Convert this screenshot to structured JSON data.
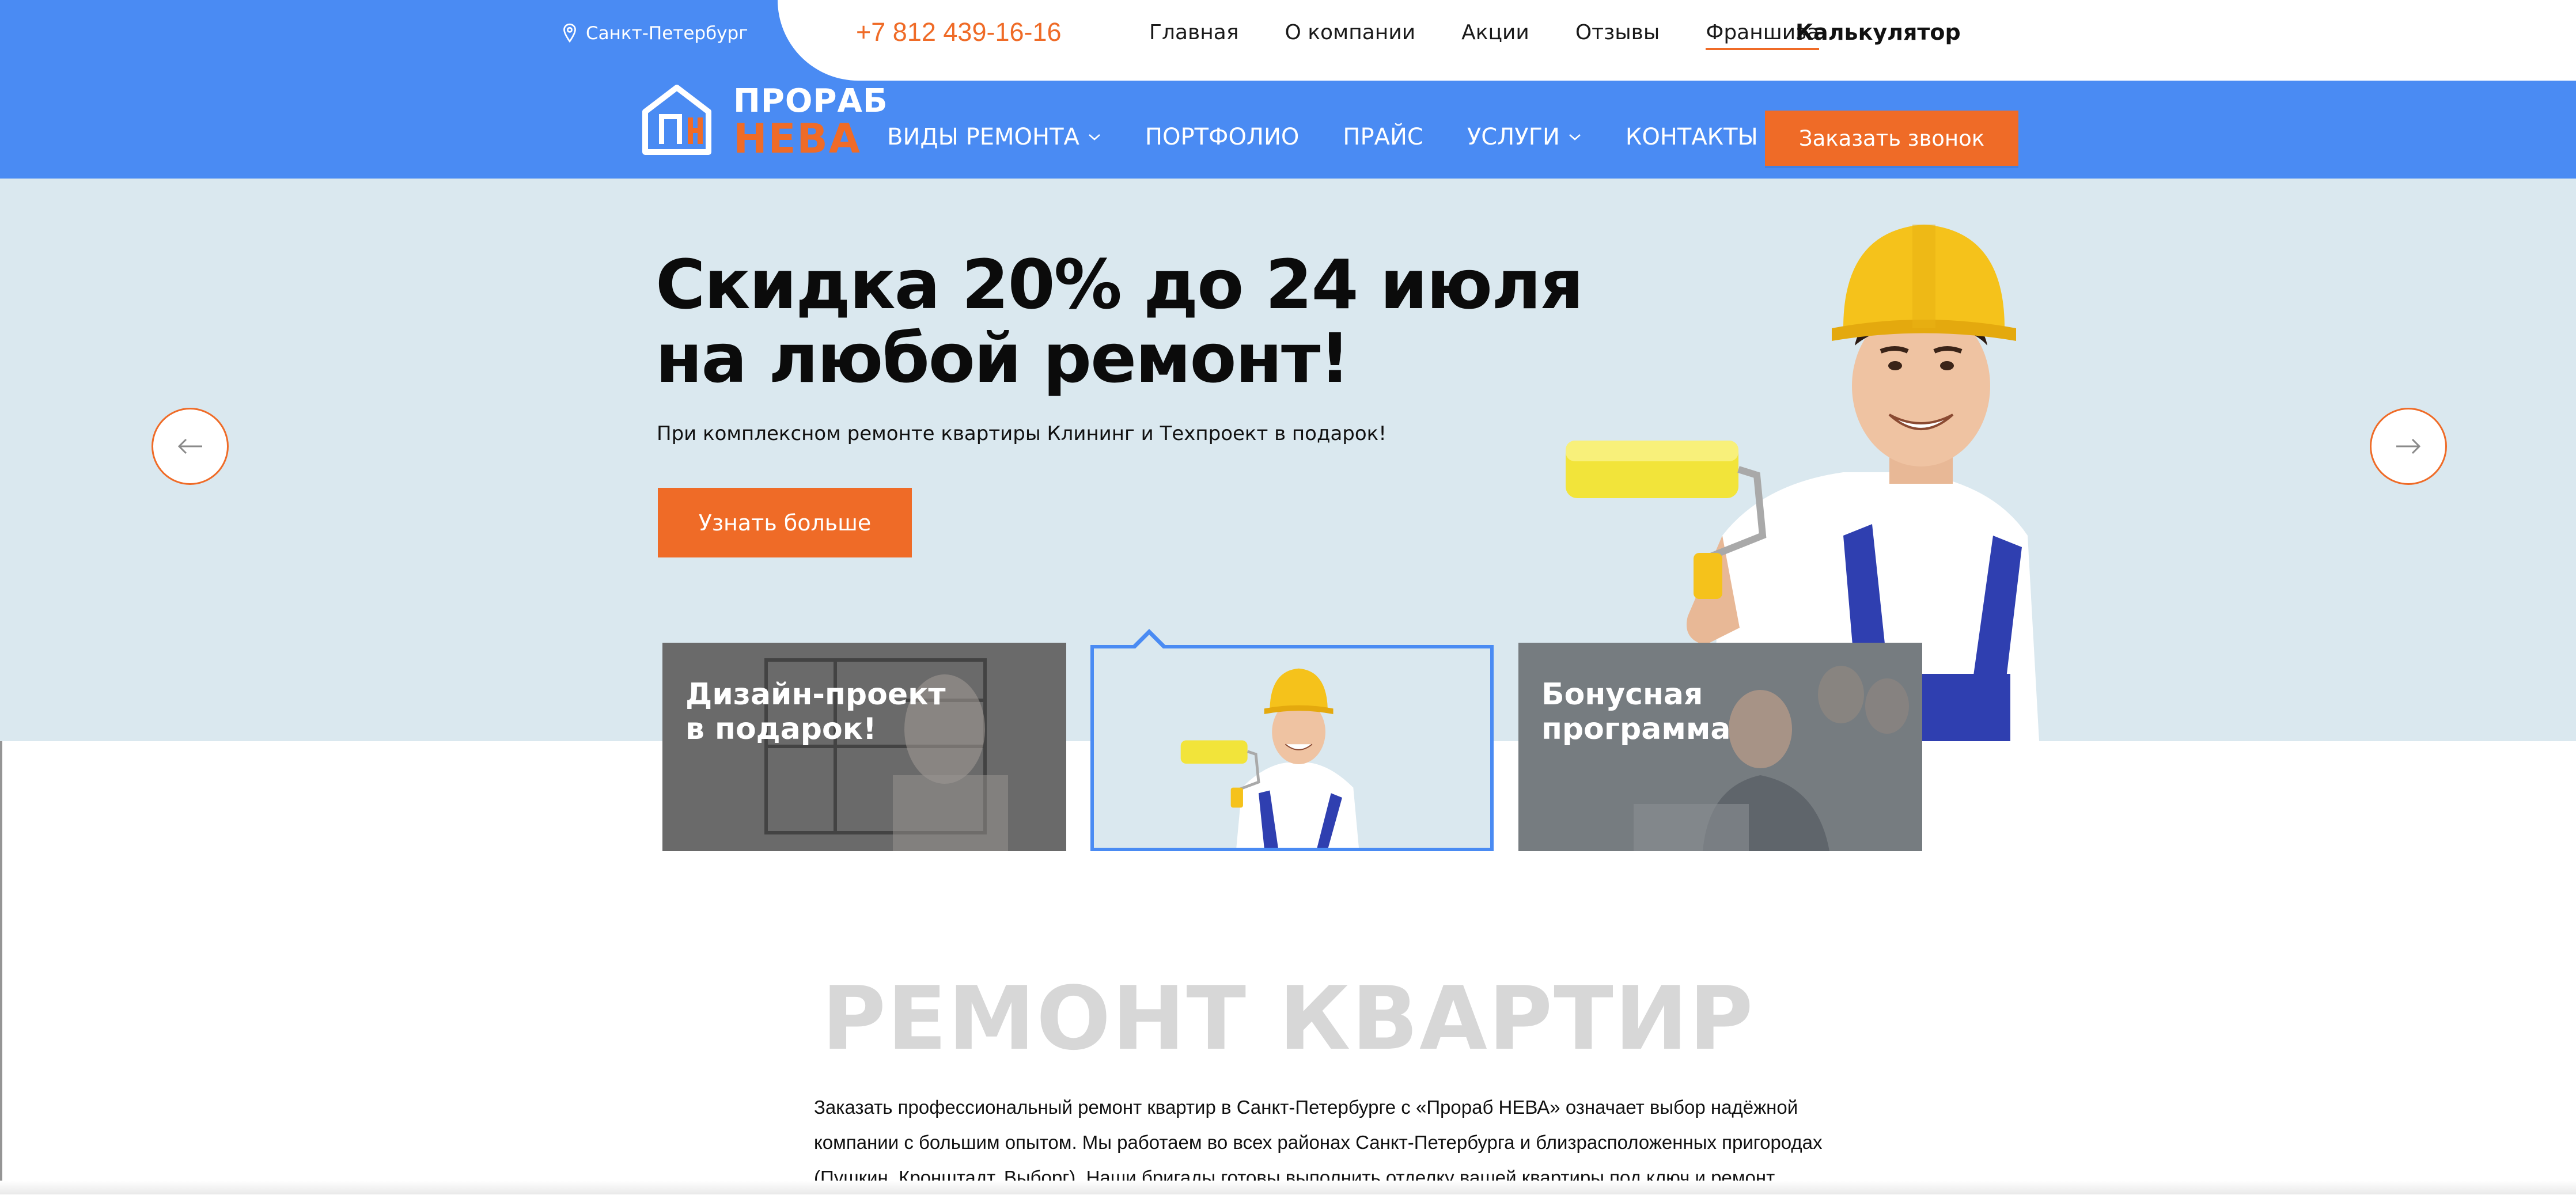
{
  "topbar": {
    "city": "Санкт-Петербург",
    "phone": "+7 812 439-16-16",
    "nav": [
      "Главная",
      "О компании",
      "Акции",
      "Отзывы",
      "Франшиза"
    ],
    "calculator": "Калькулятор"
  },
  "logo": {
    "line1": "ПРОРАБ",
    "line2": "НЕВА"
  },
  "menu": {
    "items": [
      "ВИДЫ РЕМОНТА",
      "ПОРТФОЛИО",
      "ПРАЙС",
      "УСЛУГИ",
      "КОНТАКТЫ"
    ],
    "call_button": "Заказать звонок"
  },
  "hero": {
    "title_line1": "Скидка 20% до 24 июля",
    "title_line2": "на любой ремонт!",
    "subtitle": "При комплексном ремонте квартиры Клининг и Техпроект в подарок!",
    "button": "Узнать больше"
  },
  "cards": {
    "card1_line1": "Дизайн-проект",
    "card1_line2": "в подарок!",
    "card3_line1": "Бонусная",
    "card3_line2": "программа"
  },
  "section": {
    "title": "РЕМОНТ КВАРТИР",
    "text_line1": "Заказать профессиональный ремонт квартир в Санкт-Петербурге с «Прораб НЕВА» означает выбор надёжной",
    "text_line2": "компании с большим опытом. Мы работаем во всех районах Санкт-Петербурга и близрасположенных пригородах",
    "text_line3": "(Пушкин, Кронштадт, Выборг). Наши бригады готовы выполнить отделку вашей квартиры под ключ и ремонт"
  },
  "colors": {
    "primary_blue": "#4a8bf3",
    "accent_orange": "#ef6b27",
    "hero_bg": "#dae8ef"
  },
  "icons": [
    "location-pin-icon",
    "chevron-down-icon",
    "arrow-left-icon",
    "arrow-right-icon",
    "logo-house-icon"
  ]
}
